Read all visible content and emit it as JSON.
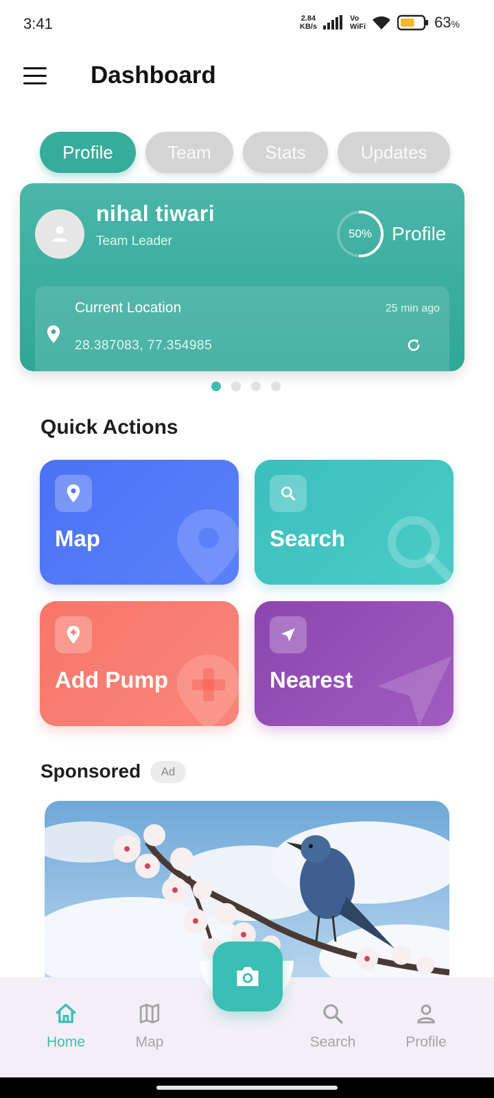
{
  "status_bar": {
    "time": "3:41",
    "net_speed_value": "2.84",
    "net_speed_unit": "KB/s",
    "vo_top": "Vo",
    "vo_bottom": "WiFi",
    "battery_value": "63",
    "battery_unit": "%",
    "battery_level": 0.63
  },
  "header": {
    "title": "Dashboard"
  },
  "tabs": [
    {
      "label": "Profile",
      "active": true
    },
    {
      "label": "Team",
      "active": false
    },
    {
      "label": "Stats",
      "active": false
    },
    {
      "label": "Updates",
      "active": false
    }
  ],
  "profile_card": {
    "name": "nihal tiwari",
    "role": "Team Leader",
    "progress_label": "50%",
    "progress_value": 0.5,
    "progress_title": "Profile",
    "location_title": "Current Location",
    "location_time": "25 min ago",
    "coordinates": "28.387083, 77.354985",
    "carousel_pages": 4,
    "carousel_active": 1
  },
  "quick_actions": {
    "title": "Quick Actions",
    "items": [
      {
        "label": "Map",
        "icon": "map-pin-icon",
        "color": "#4b72f5"
      },
      {
        "label": "Search",
        "icon": "search-icon",
        "color": "#3bbfbd"
      },
      {
        "label": "Add Pump",
        "icon": "add-location-icon",
        "color": "#f87669"
      },
      {
        "label": "Nearest",
        "icon": "navigation-arrow-icon",
        "color": "#8d45b0"
      }
    ]
  },
  "sponsored": {
    "title": "Sponsored",
    "badge": "Ad"
  },
  "bottom_nav": {
    "items": [
      {
        "label": "Home",
        "icon": "home-icon",
        "active": true
      },
      {
        "label": "Map",
        "icon": "map-icon",
        "active": false
      },
      {
        "label": "Search",
        "icon": "search-icon",
        "active": false
      },
      {
        "label": "Profile",
        "icon": "user-icon",
        "active": false
      }
    ],
    "fab_icon": "camera-icon"
  },
  "colors": {
    "accent": "#3bbfb4",
    "card_teal": "#36ac9d",
    "chip_inactive": "#d4d4d4"
  }
}
